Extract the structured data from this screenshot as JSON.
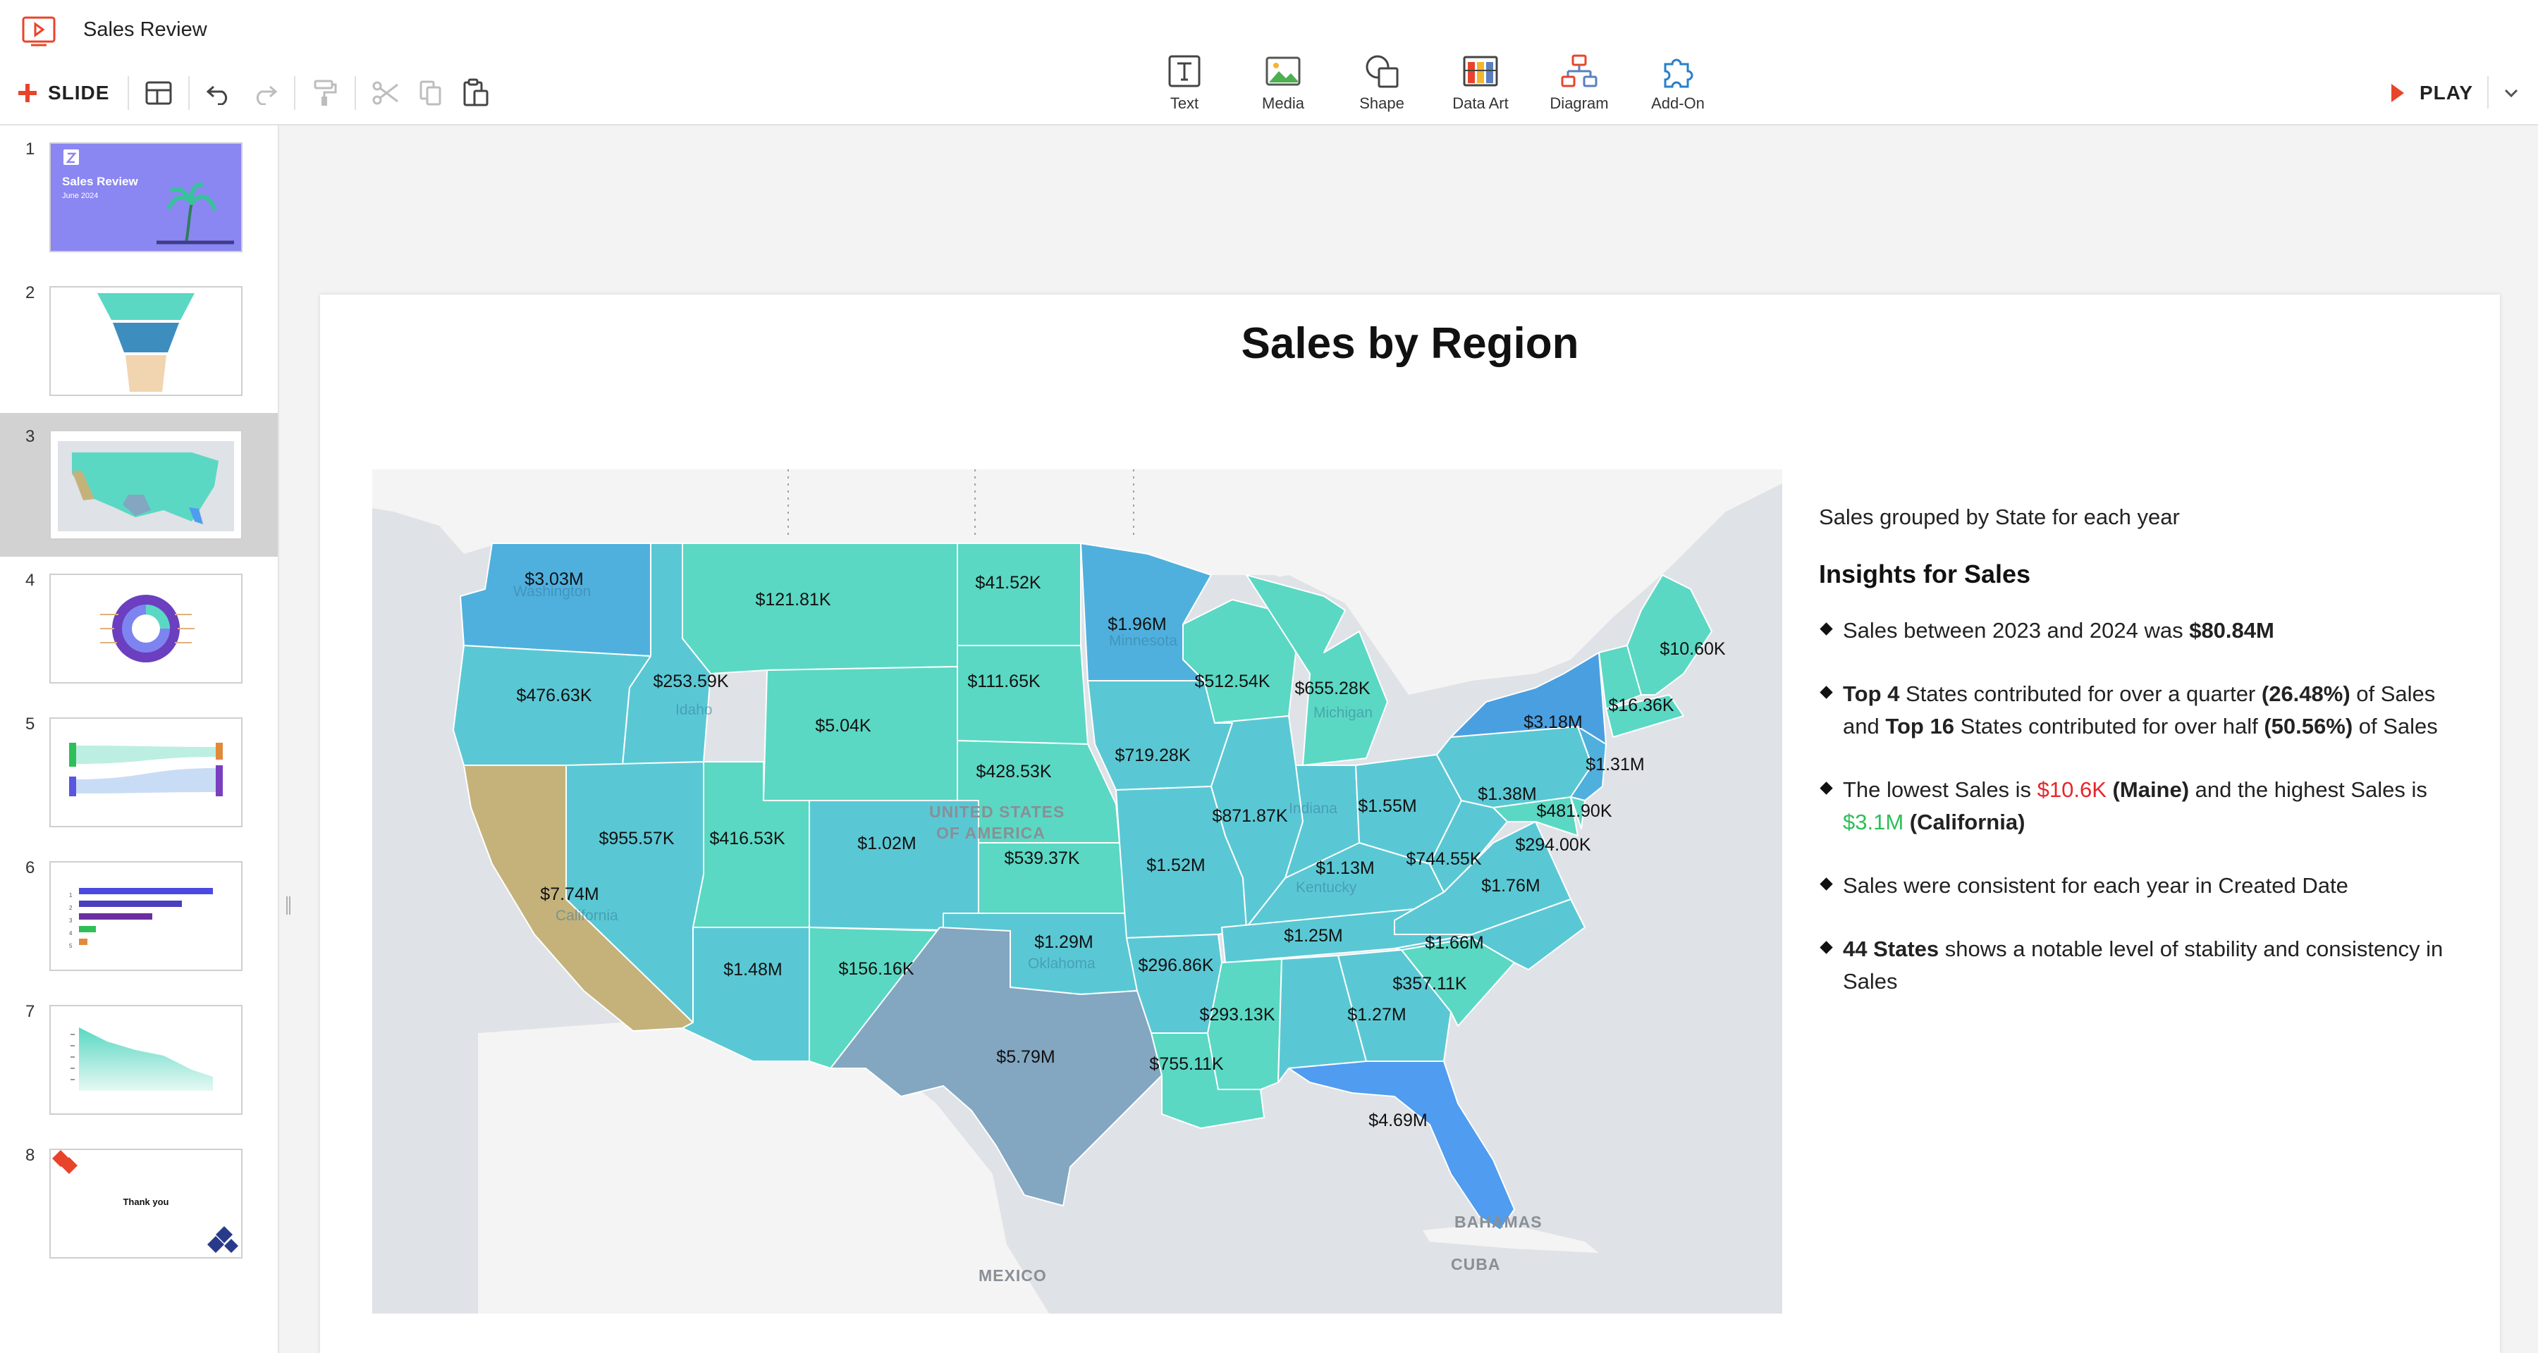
{
  "app": {
    "title": "Sales Review"
  },
  "toolbar": {
    "slide_label": "SLIDE"
  },
  "insert_toolbar": [
    {
      "label": "Text",
      "icon": "text-icon"
    },
    {
      "label": "Media",
      "icon": "media-icon"
    },
    {
      "label": "Shape",
      "icon": "shape-icon"
    },
    {
      "label": "Data Art",
      "icon": "data-art-icon"
    },
    {
      "label": "Diagram",
      "icon": "diagram-icon"
    },
    {
      "label": "Add-On",
      "icon": "add-on-icon"
    }
  ],
  "play": {
    "label": "PLAY"
  },
  "thumbnails": {
    "selected": 3,
    "items": [
      {
        "number": "1",
        "title": "Sales Review",
        "subtitle": "June 2024"
      },
      {
        "number": "2"
      },
      {
        "number": "3"
      },
      {
        "number": "4"
      },
      {
        "number": "5"
      },
      {
        "number": "6",
        "row_numbers": [
          "1",
          "2",
          "3",
          "4",
          "5"
        ]
      },
      {
        "number": "7"
      },
      {
        "number": "8",
        "title": "Thank you"
      }
    ]
  },
  "slide": {
    "title": "Sales by Region",
    "subtitle": "Sales grouped by State for each year",
    "insights_heading": "Insights for Sales",
    "insights": [
      {
        "a": "Sales between 2023 and 2024 was ",
        "b": "$80.84M"
      },
      {
        "a": "Top 4",
        "b": " States contributed for over a quarter ",
        "c": "(26.48%)",
        "d": " of Sales and ",
        "e": "Top 16",
        "f": " States contributed for over half ",
        "g": "(50.56%)",
        "h": " of Sales"
      },
      {
        "a": "The lowest Sales is ",
        "b": "$10.6K",
        "c": " (Maine)",
        "d": " and the highest Sales is ",
        "e": "$3.1M",
        "f": " (California)"
      },
      {
        "a": "Sales were consistent for each year in Created Date"
      },
      {
        "a": "44 States",
        "b": " shows a notable level of stability and consistency in Sales"
      }
    ]
  },
  "map": {
    "place_labels": {
      "mexico": "MEXICO",
      "bahamas": "BAHAMAS",
      "cuba": "CUBA",
      "usa_line1": "UNITED STATES",
      "usa_line2": "OF AMERICA"
    },
    "states": {
      "WA": {
        "name": "Washington",
        "value": "$3.03M"
      },
      "OR": {
        "value": "$476.63K"
      },
      "CA": {
        "name": "California",
        "value": "$7.74M"
      },
      "ID": {
        "name": "Idaho",
        "value": "$253.59K"
      },
      "NV": {
        "value": "$955.57K"
      },
      "MT": {
        "value": "$121.81K"
      },
      "WY": {
        "value": "$5.04K"
      },
      "UT": {
        "value": "$416.53K"
      },
      "AZ": {
        "value": "$1.48M"
      },
      "CO": {
        "value": "$1.02M"
      },
      "NM": {
        "value": "$156.16K"
      },
      "ND": {
        "value": "$41.52K"
      },
      "SD": {
        "value": "$111.65K"
      },
      "NE": {
        "value": "$428.53K"
      },
      "KS": {
        "value": "$539.37K"
      },
      "OK": {
        "name": "Oklahoma",
        "value": "$1.29M"
      },
      "TX": {
        "value": "$5.79M"
      },
      "MN": {
        "name": "Minnesota",
        "value": "$1.96M"
      },
      "IA": {
        "value": "$719.28K"
      },
      "MO": {
        "value": "$1.52M"
      },
      "AR": {
        "value": "$296.86K"
      },
      "LA": {
        "value": "$755.11K"
      },
      "WI": {
        "value": "$512.54K"
      },
      "IL": {
        "value": "$871.87K"
      },
      "MI": {
        "name": "Michigan",
        "value": "$655.28K"
      },
      "IN": {
        "name": "Indiana",
        "value": "$1.55M"
      },
      "OH": {
        "value": "$1.38M"
      },
      "KY": {
        "name": "Kentucky",
        "value": "$1.13M"
      },
      "TN": {
        "value": "$1.25M"
      },
      "MS": {
        "value": "$293.13K"
      },
      "AL": {
        "value": "$1.27M"
      },
      "GA": {
        "value": "$357.11K"
      },
      "FL": {
        "value": "$4.69M"
      },
      "SC": {
        "value": "$1.66M"
      },
      "NC": {
        "value": "$1.76M"
      },
      "VA": {
        "value": "$744.55K"
      },
      "WV": {
        "value": "$294.00K"
      },
      "PA": {
        "value": "$481.90K"
      },
      "NY": {
        "value": "$3.18M"
      },
      "NJ": {
        "value": "$1.31M"
      },
      "NH": {
        "value": "$16.36K"
      },
      "ME": {
        "value": "$10.60K"
      }
    }
  },
  "colors": {
    "accent": "#e8442b",
    "thumb_cover": "#8a86f2",
    "ca_fill": "#c4b27a",
    "tx_fill": "#83a6c1",
    "fl_fill": "#4f9cf0",
    "turquoise": "#5ad8c3",
    "blue": "#4fb0de"
  }
}
